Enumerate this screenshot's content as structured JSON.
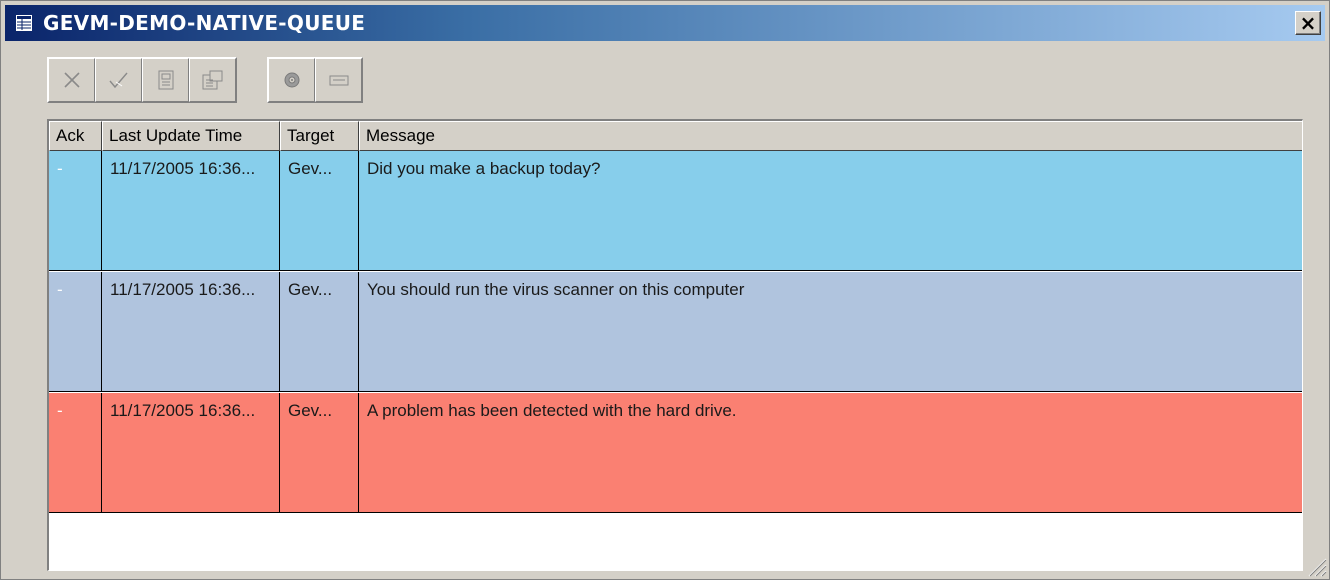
{
  "window": {
    "title": "GEVM-DEMO-NATIVE-QUEUE",
    "close_label": "×"
  },
  "toolbar": {
    "group1": [
      {
        "name": "delete-button",
        "icon": "x-icon"
      },
      {
        "name": "acknowledge-button",
        "icon": "checkmark-icon"
      },
      {
        "name": "export-button",
        "icon": "document-icon"
      },
      {
        "name": "properties-button",
        "icon": "properties-icon"
      }
    ],
    "group2": [
      {
        "name": "refresh-button",
        "icon": "disc-icon"
      },
      {
        "name": "filter-button",
        "icon": "field-icon"
      }
    ]
  },
  "table": {
    "columns": [
      "Ack",
      "Last Update Time",
      "Target",
      "Message"
    ],
    "rows": [
      {
        "ack": "-",
        "time": "11/17/2005 16:36...",
        "target": "Gev...",
        "message": "Did you make a backup today?",
        "color": "#87ceeb"
      },
      {
        "ack": "-",
        "time": "11/17/2005 16:36...",
        "target": "Gev...",
        "message": "You should run the virus scanner on this computer",
        "color": "#b0c4de"
      },
      {
        "ack": "-",
        "time": "11/17/2005 16:36...",
        "target": "Gev...",
        "message": "A problem has been detected with the hard drive.",
        "color": "#fa8072"
      }
    ]
  },
  "colors": {
    "title_gradient_start": "#0a246a",
    "title_gradient_end": "#a6caf0",
    "window_bg": "#d4d0c8"
  }
}
